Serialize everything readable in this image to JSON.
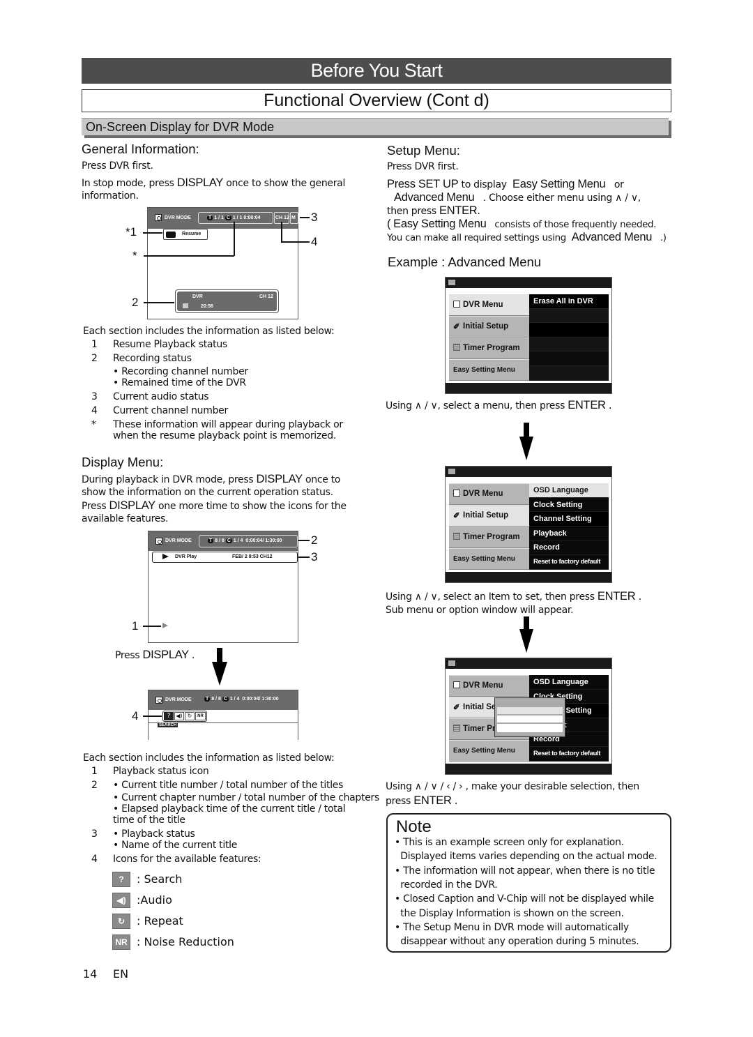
{
  "header": {
    "chapter": "Before You Start",
    "title": "Functional Overview (Cont    d)",
    "section": "On-Screen Display for DVR Mode"
  },
  "general_info": {
    "heading": "General Information:",
    "step1": "Press DVR first.",
    "step2_a": "In stop mode, press",
    "step2_key": "DISPLAY",
    "step2_b": "once to show the general",
    "step2_c": "information.",
    "osd": {
      "mode_label": "DVR MODE",
      "title_badge": "T",
      "title_value": "1 / 1",
      "chapter_badge": "C",
      "chapter_value": "1 / 1",
      "time": "0:00:04",
      "channel": "CH 12",
      "audio": "M",
      "resume_label": "Resume",
      "rec_label": "DVR",
      "rec_channel": "CH 12",
      "rec_time": "20:56"
    },
    "callouts": [
      "*1",
      "*",
      "2",
      "3",
      "4"
    ],
    "list_intro": "Each section includes the information as listed below:",
    "list": [
      {
        "num": "1",
        "text": "Resume Playback status"
      },
      {
        "num": "2",
        "text": "Recording status"
      },
      {
        "num": "",
        "text": "• Recording channel number"
      },
      {
        "num": "",
        "text": "• Remained time of the DVR"
      },
      {
        "num": "3",
        "text": "Current audio status"
      },
      {
        "num": "4",
        "text": "Current channel number"
      },
      {
        "num": "*",
        "text": "These information will appear during playback or"
      },
      {
        "num": "",
        "text": "when the resume playback point is memorized."
      }
    ]
  },
  "display_menu": {
    "heading": "Display Menu:",
    "p1_a": "During playback in DVR mode, press",
    "p1_key": "DISPLAY",
    "p1_b": "once to",
    "p2": "show the information on the current operation status.",
    "p3_a": "Press",
    "p3_key": "DISPLAY",
    "p3_b": "one more time to show the icons for the",
    "p4": "available features.",
    "osd": {
      "mode_label": "DVR MODE",
      "title_badge": "T",
      "title_value": "8 / 8",
      "chapter_badge": "C",
      "chapter_value": "1 / 4",
      "time": "0:00:04/ 1:30:00",
      "status": "DVR  Play",
      "title_name": "FEB/ 2 8:53 CH12",
      "search_label": "SEARCH",
      "nr_label": "NR"
    },
    "press_display_a": "Press",
    "press_display_key": "DISPLAY .",
    "callouts": [
      "2",
      "3",
      "1",
      "4"
    ],
    "list_intro": "Each section includes the information as listed below:",
    "list": [
      {
        "num": "1",
        "text": "Playback status icon"
      },
      {
        "num": "2",
        "text": "• Current title number / total number of the titles"
      },
      {
        "num": "",
        "text": "• Current chapter number / total number of the chapters"
      },
      {
        "num": "",
        "text": "• Elapsed playback time of the current title / total"
      },
      {
        "num": "",
        "text": "  time of the title"
      },
      {
        "num": "3",
        "text": "• Playback status"
      },
      {
        "num": "",
        "text": "• Name of the current title"
      },
      {
        "num": "4",
        "text": "Icons for the available features:"
      }
    ],
    "features": [
      {
        "icon": "search-icon",
        "label": ": Search"
      },
      {
        "icon": "audio-icon",
        "label": ":Audio"
      },
      {
        "icon": "repeat-icon",
        "label": ": Repeat"
      },
      {
        "icon": "noise-reduction-icon",
        "label": ": Noise Reduction"
      }
    ]
  },
  "setup_menu": {
    "heading": "Setup Menu:",
    "step1": "Press DVR first.",
    "l1_a": "Press",
    "l1_key": "SET UP",
    "l1_b": "to display",
    "l1_opt": "Easy Setting Menu",
    "l1_c": "or",
    "l2_opt": "Advanced Menu",
    "l2_b": ". Choose either menu using ∧ / ∨,",
    "l3_a": "then press",
    "l3_key": "ENTER.",
    "l4_a": "(",
    "l4_opt": "Easy Setting Menu",
    "l4_b": "consists of those frequently needed.",
    "l5_a": "You can make all required settings using",
    "l5_opt": "Advanced Menu",
    "l5_b": ".)",
    "example_heading": "Example : Advanced Menu",
    "left_menu": [
      "DVR Menu",
      "Initial Setup",
      "Timer Program",
      "Easy Setting Menu"
    ],
    "screen1_right": [
      "Erase All in DVR",
      "",
      "",
      "",
      "",
      ""
    ],
    "screen2_right": [
      "OSD Language",
      "Clock Setting",
      "Channel Setting",
      "Playback",
      "Record",
      "Reset to factory default"
    ],
    "screen3_right": [
      "OSD Language",
      "Clock Setting",
      "Channel Setting",
      "Playback",
      "Record",
      "Reset to factory default"
    ],
    "step_a_text": "Using  ∧ / ∨, select a menu, then press",
    "step_a_key": "ENTER .",
    "step_b_text": "Using  ∧ / ∨, select an Item to set, then press",
    "step_b_key": "ENTER .",
    "step_b_line2": "Sub menu or option window will appear.",
    "step_c_text": "Using ∧ / ∨ / ‹ / › , make your desirable selection, then",
    "step_c_line2_a": "press",
    "step_c_line2_key": "ENTER ."
  },
  "note": {
    "title": "Note",
    "bullets": [
      "• This is an example screen only for explanation.",
      "  Displayed items varies depending on the actual mode.",
      "• The information will not appear, when there is no title",
      "  recorded in the DVR.",
      "• Closed Caption and V-Chip will not be displayed while",
      "  the Display Information is shown on the screen.",
      "• The Setup Menu in DVR mode will automatically",
      "  disappear without any operation during 5 minutes."
    ]
  },
  "footer": {
    "page_number": "14",
    "language": "EN"
  }
}
